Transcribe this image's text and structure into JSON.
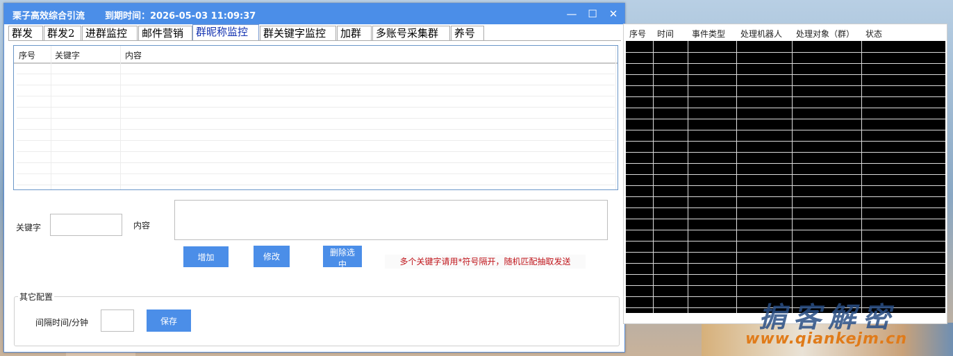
{
  "window": {
    "title": "栗子高效综合引流",
    "expiry": "到期时间：2026-05-03 11:09:37",
    "min_icon": "minimize-icon",
    "max_icon": "maximize-icon",
    "close_icon": "close-icon"
  },
  "tabs": [
    "群发",
    "群发2",
    "进群监控",
    "邮件营销",
    "群昵称监控",
    "群关键字监控",
    "加群",
    "多账号采集群",
    "养号"
  ],
  "active_tab": "群昵称监控",
  "keyword_table": {
    "columns": [
      "序号",
      "关键字",
      "内容"
    ],
    "rows": []
  },
  "form": {
    "keyword_label": "关键字",
    "keyword_value": "",
    "content_label": "内容",
    "content_value": "",
    "add_button": "增加",
    "edit_button": "修改",
    "delete_button": "删除选中",
    "hint": "多个关键字请用*符号隔开，随机匹配抽取发送"
  },
  "other_config": {
    "title": "其它配置",
    "interval_label": "间隔时间/分钟",
    "interval_value": "",
    "save_button": "保存"
  },
  "log_table": {
    "columns": [
      "序号",
      "时间",
      "事件类型",
      "处理机器人",
      "处理对象（群）",
      "状态"
    ],
    "rows": []
  },
  "watermark": {
    "cn": "掮客解密",
    "url": "www.qiankejm.cn"
  },
  "colors": {
    "accent": "#4b8ee8",
    "warning": "#c0151b",
    "log_bg": "#000000"
  }
}
